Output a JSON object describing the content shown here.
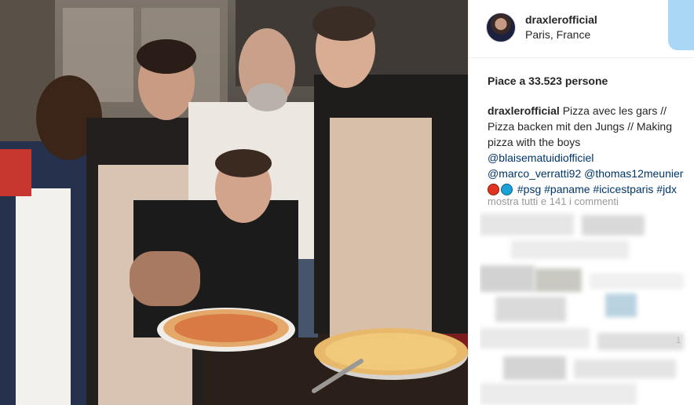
{
  "post": {
    "username": "draxlerofficial",
    "location": "Paris, France",
    "likes_text": "Piace a 33.523 persone",
    "caption": {
      "author": "draxlerofficial",
      "line1": "Pizza avec les gars //",
      "line2": "Pizza backen mit den Jungs // Making",
      "line3": "pizza with the boys",
      "mention1": "@blaisematuidiofficiel",
      "mention2": "@marco_verratti92",
      "mention3": "@thomas12meunier",
      "hashtags": "#psg #paname #icicestparis #jdx"
    },
    "emoji": [
      {
        "name": "red-circle-emoji",
        "color": "#e0341f"
      },
      {
        "name": "blue-circle-emoji",
        "color": "#19a3d8"
      }
    ],
    "comments_link": "mostra tutti e 141 i commenti",
    "blurred_count_hint": "1"
  },
  "colors": {
    "text": "#262626",
    "link": "#003569",
    "muted": "#999999",
    "border": "#efefef",
    "follow_accent": "#a9d7f5"
  },
  "photo": {
    "subject": "five men in aprons posing behind pizzas in a restaurant"
  }
}
